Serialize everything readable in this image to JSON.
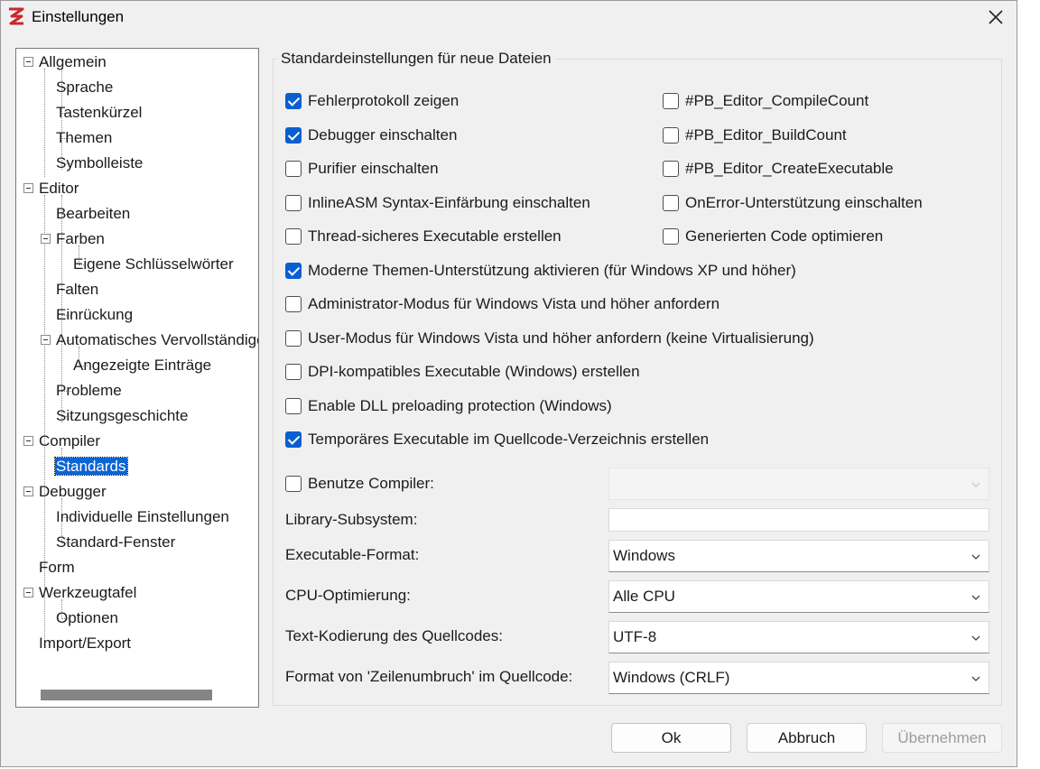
{
  "window": {
    "title": "Einstellungen"
  },
  "tree": {
    "items": [
      {
        "label": "Allgemein"
      },
      {
        "label": "Sprache"
      },
      {
        "label": "Tastenkürzel"
      },
      {
        "label": "Themen"
      },
      {
        "label": "Symbolleiste"
      },
      {
        "label": "Editor"
      },
      {
        "label": "Bearbeiten"
      },
      {
        "label": "Farben"
      },
      {
        "label": "Eigene Schlüsselwörter"
      },
      {
        "label": "Falten"
      },
      {
        "label": "Einrückung"
      },
      {
        "label": "Automatisches Vervollständigen"
      },
      {
        "label": "Angezeigte Einträge"
      },
      {
        "label": "Probleme"
      },
      {
        "label": "Sitzungsgeschichte"
      },
      {
        "label": "Compiler"
      },
      {
        "label": "Standards"
      },
      {
        "label": "Debugger"
      },
      {
        "label": "Individuelle Einstellungen"
      },
      {
        "label": "Standard-Fenster"
      },
      {
        "label": "Form"
      },
      {
        "label": "Werkzeugtafel"
      },
      {
        "label": "Optionen"
      },
      {
        "label": "Import/Export"
      }
    ],
    "selected": "Standards"
  },
  "group": {
    "title": "Standardeinstellungen für neue Dateien"
  },
  "checkboxes": {
    "fehlerprotokoll": {
      "label": "Fehlerprotokoll zeigen",
      "checked": true
    },
    "debugger": {
      "label": "Debugger einschalten",
      "checked": true
    },
    "purifier": {
      "label": "Purifier einschalten",
      "checked": false
    },
    "inlineasm": {
      "label": "InlineASM Syntax-Einfärbung einschalten",
      "checked": false
    },
    "threadsafe": {
      "label": "Thread-sicheres Executable erstellen",
      "checked": false
    },
    "compilecount": {
      "label": "#PB_Editor_CompileCount",
      "checked": false
    },
    "buildcount": {
      "label": "#PB_Editor_BuildCount",
      "checked": false
    },
    "createexe": {
      "label": "#PB_Editor_CreateExecutable",
      "checked": false
    },
    "onerror": {
      "label": "OnError-Unterstützung einschalten",
      "checked": false
    },
    "optimize": {
      "label": "Generierten Code optimieren",
      "checked": false
    },
    "themes": {
      "label": "Moderne Themen-Unterstützung aktivieren (für Windows XP und höher)",
      "checked": true
    },
    "admin": {
      "label": "Administrator-Modus für Windows Vista und höher anfordern",
      "checked": false
    },
    "usermode": {
      "label": "User-Modus für Windows Vista und höher anfordern (keine Virtualisierung)",
      "checked": false
    },
    "dpi": {
      "label": "DPI-kompatibles Executable (Windows) erstellen",
      "checked": false
    },
    "dll": {
      "label": "Enable DLL preloading protection (Windows)",
      "checked": false
    },
    "tempexe": {
      "label": "Temporäres Executable im Quellcode-Verzeichnis erstellen",
      "checked": true
    },
    "compiler": {
      "label": "Benutze Compiler:",
      "checked": false
    }
  },
  "fields": {
    "compiler_value": "",
    "library_label": "Library-Subsystem:",
    "library_value": "",
    "exe_format_label": "Executable-Format:",
    "exe_format_value": "Windows",
    "cpu_label": "CPU-Optimierung:",
    "cpu_value": "Alle CPU",
    "encoding_label": "Text-Kodierung des Quellcodes:",
    "encoding_value": "UTF-8",
    "newline_label": "Format von 'Zeilenumbruch' im Quellcode:",
    "newline_value": "Windows (CRLF)"
  },
  "buttons": {
    "ok": "Ok",
    "cancel": "Abbruch",
    "apply": "Übernehmen"
  },
  "colors": {
    "accent": "#0a64d6",
    "checkbox_checked": "#0a5fd0"
  }
}
